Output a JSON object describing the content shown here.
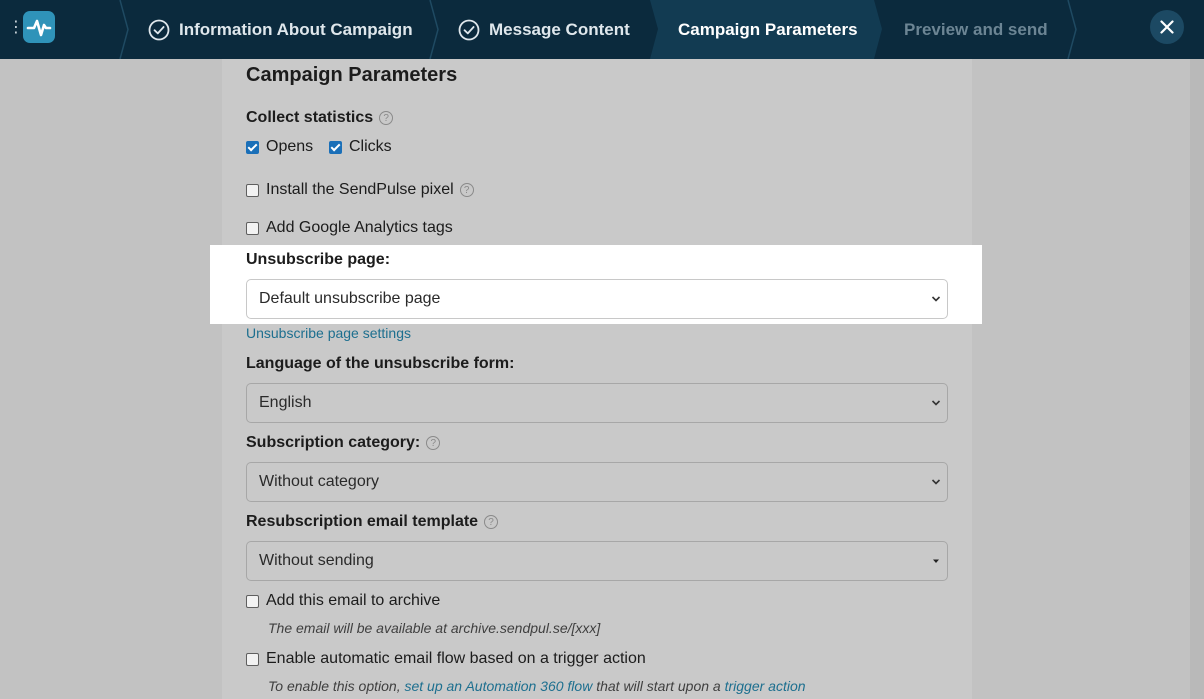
{
  "steps": {
    "step1": "Information About Campaign",
    "step2": "Message Content",
    "step3": "Campaign Parameters",
    "step4": "Preview and send"
  },
  "page": {
    "title": "Campaign Parameters"
  },
  "statistics": {
    "label": "Collect statistics",
    "opens": "Opens",
    "clicks": "Clicks",
    "opens_checked": true,
    "clicks_checked": true
  },
  "pixel": {
    "label": "Install the SendPulse pixel",
    "checked": false
  },
  "ga_tags": {
    "label": "Add Google Analytics tags",
    "checked": false
  },
  "unsubscribe": {
    "label": "Unsubscribe page:",
    "value": "Default unsubscribe page",
    "settings_link": "Unsubscribe page settings"
  },
  "language": {
    "label": "Language of the unsubscribe form:",
    "value": "English"
  },
  "category": {
    "label": "Subscription category:",
    "value": "Without category"
  },
  "resubscription": {
    "label": "Resubscription email template",
    "value": "Without sending"
  },
  "archive": {
    "label": "Add this email to archive",
    "checked": false,
    "note": "The email will be available at archive.sendpul.se/[xxx]"
  },
  "automation": {
    "label": "Enable automatic email flow based on a trigger action",
    "checked": false,
    "note_prefix": "To enable this option,",
    "note_link1": "set up an Automation 360 flow",
    "note_middle": "that will start upon a",
    "note_link2": "trigger action"
  },
  "colors": {
    "topbar": "#0b2a3d",
    "accent": "#2f93b9",
    "link": "#1d6f8f",
    "checkbox": "#1a6fb8"
  }
}
